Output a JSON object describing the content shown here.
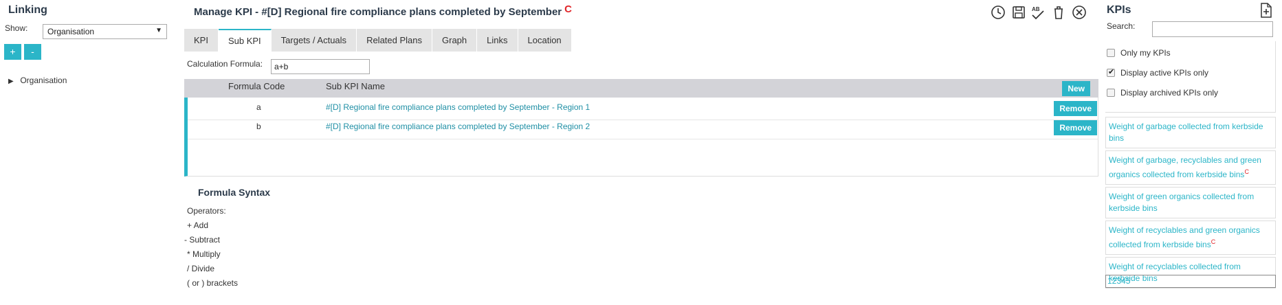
{
  "linking": {
    "title": "Linking",
    "show_label": "Show:",
    "show_value": "Organisation",
    "add_label": "+",
    "remove_label": "-",
    "tree_toggle": "▶",
    "tree_item": "Organisation"
  },
  "header": {
    "title": "Manage KPI - #[D] Regional fire compliance plans completed by September",
    "mark": "C"
  },
  "toolbar": {
    "icons": [
      "history-icon",
      "save-icon",
      "spellcheck-icon",
      "delete-icon",
      "close-icon"
    ],
    "spell_text": "AB"
  },
  "tabs": [
    {
      "label": "KPI",
      "active": false
    },
    {
      "label": "Sub KPI",
      "active": true
    },
    {
      "label": "Targets / Actuals",
      "active": false
    },
    {
      "label": "Related Plans",
      "active": false
    },
    {
      "label": "Graph",
      "active": false
    },
    {
      "label": "Links",
      "active": false
    },
    {
      "label": "Location",
      "active": false
    }
  ],
  "formula": {
    "label": "Calculation Formula:",
    "value": "a+b"
  },
  "grid": {
    "col_code": "Formula Code",
    "col_name": "Sub KPI Name",
    "new_label": "New",
    "remove_label": "Remove",
    "rows": [
      {
        "code": "a",
        "name": "#[D] Regional fire compliance plans completed by September - Region 1"
      },
      {
        "code": "b",
        "name": "#[D] Regional fire compliance plans completed by September - Region 2"
      }
    ]
  },
  "syntax": {
    "title": "Formula Syntax",
    "lines": [
      "Operators:",
      "+ Add",
      "- Subtract",
      "* Multiply",
      "/ Divide",
      "( or ) brackets"
    ]
  },
  "kpis": {
    "title": "KPIs",
    "search_label": "Search:",
    "search_value": "",
    "filters": [
      {
        "label": "Only my KPIs",
        "checked": false
      },
      {
        "label": "Display active KPIs only",
        "checked": true
      },
      {
        "label": "Display archived KPIs only",
        "checked": false
      }
    ],
    "items": [
      {
        "text": "Weight of garbage collected from kerbside bins",
        "mark": ""
      },
      {
        "text": "Weight of garbage, recyclables and green organics collected from kerbside bins",
        "mark": "C"
      },
      {
        "text": "Weight of green organics collected from kerbside bins",
        "mark": ""
      },
      {
        "text": "Weight of recyclables and green organics collected from kerbside bins",
        "mark": "C"
      },
      {
        "text": "Weight of recyclables collected from kerbside bins",
        "mark": ""
      }
    ],
    "pager": "12345"
  },
  "colors": {
    "accent": "#2bb5c8",
    "link": "#1f8fa5",
    "mark": "#e0262a",
    "header_bg": "#d3d3d8",
    "tab_bg": "#e4e4e4"
  }
}
